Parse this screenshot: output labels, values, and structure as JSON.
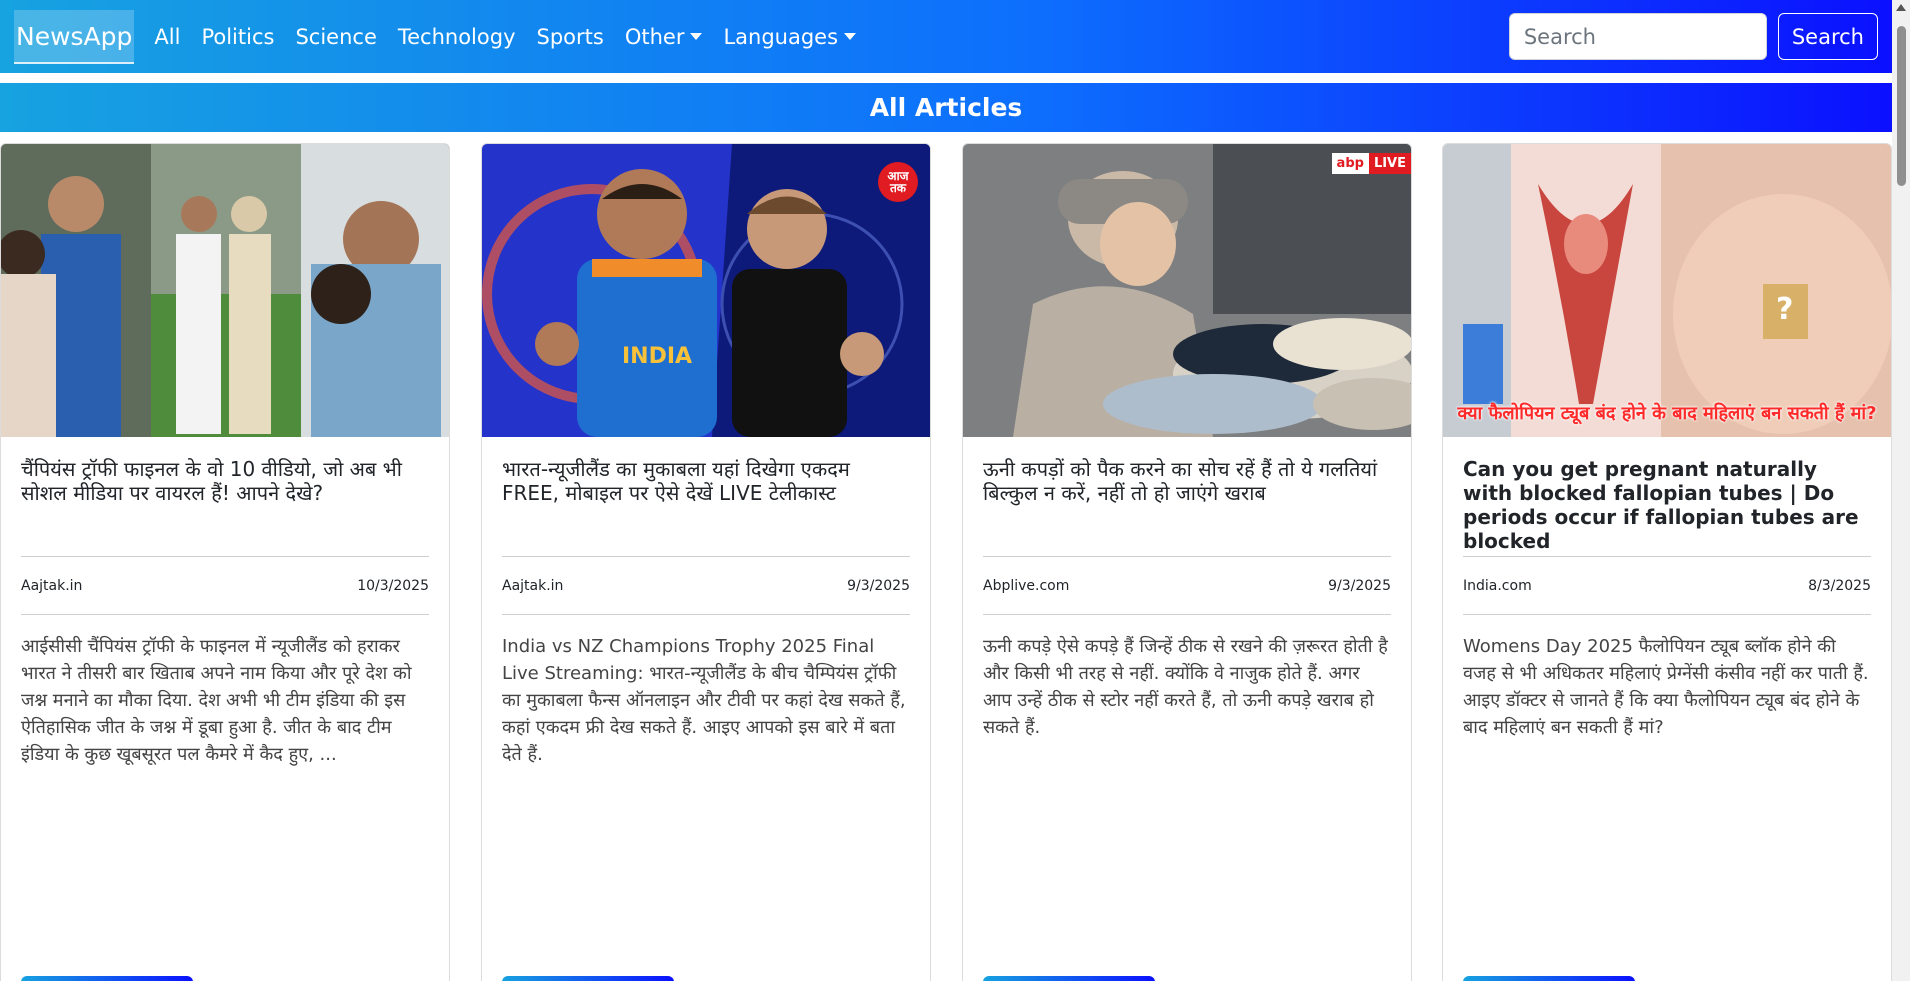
{
  "nav": {
    "brand": "NewsApp",
    "items": [
      "All",
      "Politics",
      "Science",
      "Technology",
      "Sports"
    ],
    "dropdowns": [
      "Other",
      "Languages"
    ],
    "search_placeholder": "Search",
    "search_button": "Search"
  },
  "banner": {
    "title": "All Articles"
  },
  "articles": [
    {
      "title": "चैंपियंस ट्रॉफी फाइनल के वो 10 वीडियो, जो अब भी सोशल मीडिया पर वायरल हैं! आपने देखे?",
      "source": "Aajtak.in",
      "date": "10/3/2025",
      "description": "आईसीसी चैंपियंस ट्रॉफी के फाइनल में न्यूजीलैंड को हराकर भारत ने तीसरी बार खिताब अपने नाम किया और पूरे देश को जश्न मनाने का मौका दिया. देश अभी भी टीम इंडिया की इस ऐतिहासिक जीत के जश्न में डूबा हुआ है. जीत के बाद टीम इंडिया के कुछ खूबसूरत पल कैमरे में कैद हुए, ..."
    },
    {
      "title": "भारत-न्यूजीलैंड का मुकाबला यहां दिखेगा एकदम FREE, मोबाइल पर ऐसे देखें LIVE टेलीकास्ट",
      "source": "Aajtak.in",
      "date": "9/3/2025",
      "description": "India vs NZ Champions Trophy 2025 Final Live Streaming: भारत-न्यूजीलैंड के बीच चैम्पियंस ट्रॉफी का मुकाबला फैन्स ऑनलाइन और टीवी पर कहां देख सकते हैं, कहां एकदम फ्री देख सकते हैं. आइए आपको इस बारे में बता देते हैं.",
      "image_badge": "आज तक",
      "jersey_text": "INDIA"
    },
    {
      "title": "ऊनी कपड़ों को पैक करने का सोच रहें हैं तो ये गलतियां बिल्कुल न करें, नहीं तो हो जाएंगे खराब",
      "source": "Abplive.com",
      "date": "9/3/2025",
      "description": "ऊनी कपड़े ऐसे कपड़े हैं जिन्हें ठीक से रखने की ज़रूरत होती है और किसी भी तरह से नहीं. क्योंकि वे नाजुक होते हैं. अगर आप उन्हें ठीक से स्टोर नहीं करते हैं, तो ऊनी कपड़े खराब हो सकते हैं.",
      "image_badge_left": "abp",
      "image_badge_right": "LIVE"
    },
    {
      "title": "Can you get pregnant naturally with blocked fallopian tubes | Do periods occur if fallopian tubes are blocked",
      "source": "India.com",
      "date": "8/3/2025",
      "description": "Womens Day 2025 फैलोपियन ट्यूब ब्लॉक होने की वजह से भी अधिकतर महिलाएं प्रेग्नेंसी कंसीव नहीं कर पाती हैं. आइए डॉक्टर से जानते हैं कि क्या फैलोपियन ट्यूब बंद होने के बाद महिलाएं बन सकती हैं मां?",
      "image_overlay": "क्या फैलोपियन ट्यूब बंद होने के बाद महिलाएं बन सकती हैं मां?",
      "image_sign": "?"
    }
  ]
}
